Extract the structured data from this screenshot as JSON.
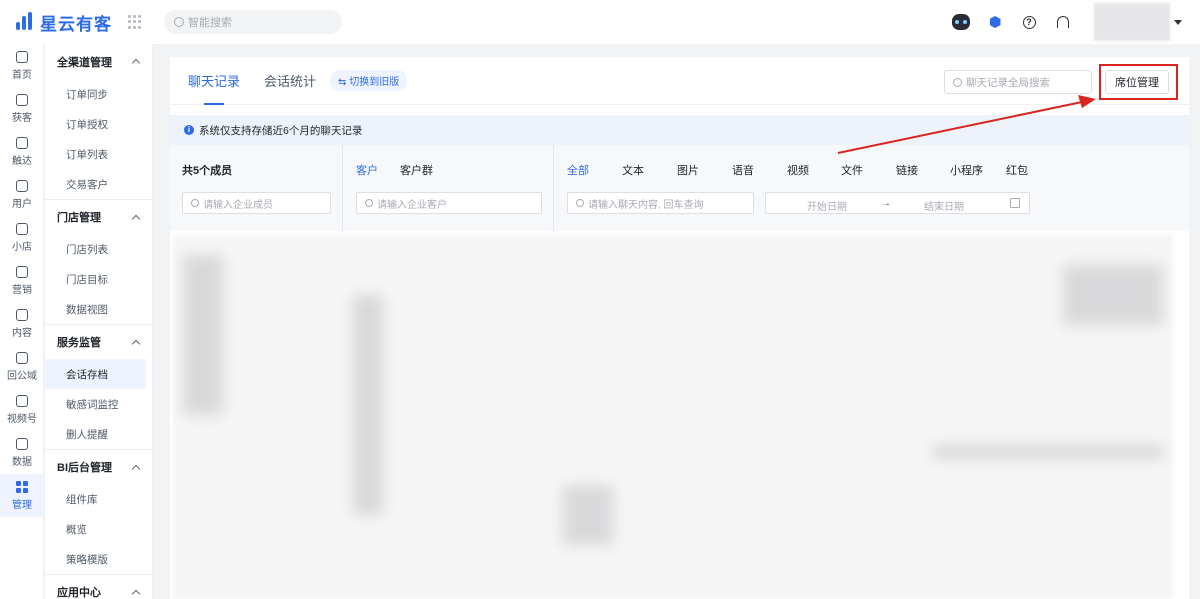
{
  "header": {
    "logo_text": "星云有客",
    "search_placeholder": "智能搜索",
    "icons": [
      "robot-icon",
      "cube-icon",
      "help-icon",
      "headset-icon"
    ]
  },
  "rail": [
    {
      "label": "首页",
      "icon": "home-icon"
    },
    {
      "label": "获客",
      "icon": "user-add-icon"
    },
    {
      "label": "触达",
      "icon": "send-icon"
    },
    {
      "label": "用户",
      "icon": "user-icon"
    },
    {
      "label": "小店",
      "icon": "shop-icon"
    },
    {
      "label": "营销",
      "icon": "bulb-icon"
    },
    {
      "label": "内容",
      "icon": "folder-icon"
    },
    {
      "label": "回公域",
      "icon": "crown-icon"
    },
    {
      "label": "视频号",
      "icon": "video-channel-icon"
    },
    {
      "label": "数据",
      "icon": "pie-chart-icon"
    },
    {
      "label": "管理",
      "icon": "grid-icon",
      "active": true
    }
  ],
  "sidebar": {
    "groups": [
      {
        "title": "全渠道管理",
        "items": [
          "订单同步",
          "订单授权",
          "订单列表",
          "交易客户"
        ]
      },
      {
        "title": "门店管理",
        "items": [
          "门店列表",
          "门店目标",
          "数据视图"
        ]
      },
      {
        "title": "服务监管",
        "items": [
          "会话存档",
          "敏感词监控",
          "删人提醒"
        ]
      },
      {
        "title": "BI后台管理",
        "items": [
          "组件库",
          "概览",
          "策略模版"
        ]
      },
      {
        "title": "应用中心",
        "items": []
      }
    ],
    "active_item": "会话存档"
  },
  "main": {
    "tabs": [
      "聊天记录",
      "会话统计"
    ],
    "switch_label": "⇆ 切换到旧版",
    "global_search_placeholder": "聊天记录全局搜索",
    "seat_button": "席位管理",
    "notice": "系统仅支持存储近6个月的聊天记录",
    "members_title": "共5个成员",
    "member_search_placeholder": "请输入企业成员",
    "customer_tabs": [
      "客户",
      "客户群"
    ],
    "customer_search_placeholder": "请输入企业客户",
    "message_types": [
      "全部",
      "文本",
      "图片",
      "语音",
      "视频",
      "文件",
      "链接",
      "小程序",
      "红包"
    ],
    "message_search_placeholder": "请输入聊天内容, 回车查询",
    "date_start_placeholder": "开始日期",
    "date_sep": "→",
    "date_end_placeholder": "结束日期"
  },
  "colors": {
    "accent": "#2e6be6",
    "annotation": "#d9251d"
  }
}
